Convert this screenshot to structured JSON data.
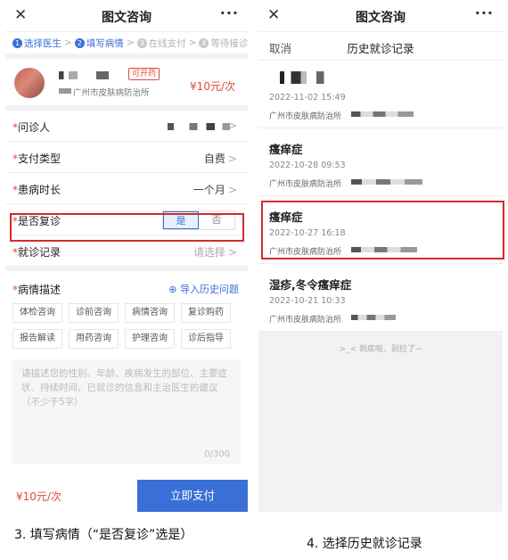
{
  "left": {
    "nav": {
      "close": "✕",
      "title": "图文咨询",
      "more": "···"
    },
    "steps": [
      {
        "num": "1",
        "label": "选择医生",
        "state": "done"
      },
      {
        "num": "2",
        "label": "填写病情",
        "state": "active"
      },
      {
        "num": "3",
        "label": "在线支付",
        "state": "pending"
      },
      {
        "num": "4",
        "label": "等待接诊",
        "state": "pending"
      }
    ],
    "doctor": {
      "badge": "可开药",
      "hospital": "广州市皮肤病防治所",
      "price": "¥10元/次"
    },
    "form": {
      "patient_label": "问诊人",
      "pay_type_label": "支付类型",
      "pay_type_value": "自费",
      "duration_label": "患病时长",
      "duration_value": "一个月",
      "revisit_label": "是否复诊",
      "revisit_yes": "是",
      "revisit_no": "否",
      "record_label": "就诊记录",
      "record_placeholder": "请选择",
      "desc_label": "病情描述",
      "import_label": "导入历史问题"
    },
    "chips": [
      "体检咨询",
      "诊前咨询",
      "病情咨询",
      "复诊购药",
      "报告解读",
      "用药咨询",
      "护理咨询",
      "诊后指导"
    ],
    "textarea": {
      "placeholder": "请描述您的性别、年龄、疾病发生的部位、主要症状、持续时间、已就诊的信息和主治医生的建议（不少于5字）",
      "count": "0/300"
    },
    "footer": {
      "price": "¥10元/次",
      "pay_button": "立即支付"
    },
    "caption": "3. 填写病情（“是否复诊”选是）"
  },
  "right": {
    "nav": {
      "close": "✕",
      "title": "图文咨询",
      "more": "···"
    },
    "sub": {
      "cancel": "取消",
      "title": "历史就诊记录"
    },
    "records": [
      {
        "name": "",
        "date": "2022-11-02 15:49",
        "hospital": "广州市皮肤病防治所"
      },
      {
        "name": "瘙痒症",
        "date": "2022-10-28 09:53",
        "hospital": "广州市皮肤病防治所"
      },
      {
        "name": "瘙痒症",
        "date": "2022-10-27 16:18",
        "hospital": "广州市皮肤病防治所"
      },
      {
        "name": "湿疹,冬令瘙痒症",
        "date": "2022-10-21 10:33",
        "hospital": "广州市皮肤病防治所"
      }
    ],
    "end_note": ">_< 到底啦、别拉了~",
    "caption": "4. 选择历史就诊记录"
  },
  "colors": {
    "accent": "#3a6fd8",
    "price_red": "#e24a3b",
    "highlight_red": "#d42a2a"
  }
}
